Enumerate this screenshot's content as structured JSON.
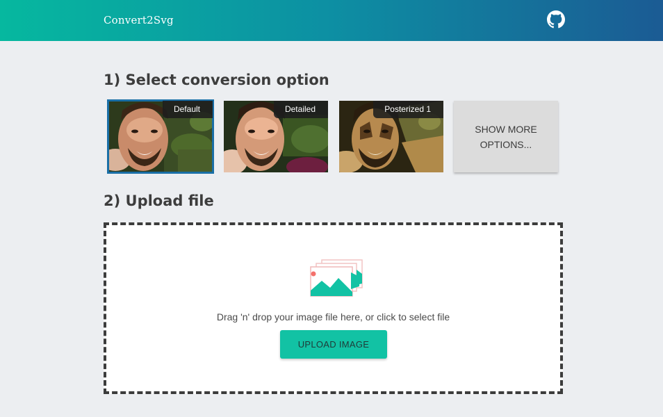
{
  "header": {
    "brand": "Convert2Svg",
    "github_icon": "github-icon",
    "gradient": [
      "#06b89f",
      "#1b5b94"
    ]
  },
  "step1": {
    "title": "1) Select conversion option"
  },
  "options": [
    {
      "label": "Default",
      "selected": true
    },
    {
      "label": "Detailed",
      "selected": false
    },
    {
      "label": "Posterized 1",
      "selected": false
    }
  ],
  "more_options": {
    "line1": "SHOW MORE",
    "line2": "OPTIONS..."
  },
  "step2": {
    "title": "2) Upload file"
  },
  "dropzone": {
    "icon": "images-icon",
    "text": "Drag 'n' drop your image file here, or click to select file",
    "button": "UPLOAD IMAGE"
  },
  "colors": {
    "accent": "#12c2a4",
    "selected_outline": "#1a6fa6",
    "background": "#eceef1"
  }
}
